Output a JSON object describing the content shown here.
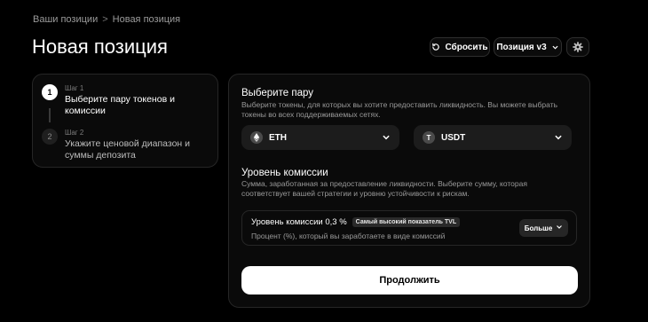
{
  "breadcrumb": {
    "parent": "Ваши позиции",
    "separator": ">",
    "current": "Новая позиция"
  },
  "header": {
    "title": "Новая позиция",
    "reset_label": "Сбросить",
    "version_label": "Позиция v3"
  },
  "steps": [
    {
      "number": "1",
      "label": "Шаг 1",
      "title": "Выберите пару токенов и комиссии"
    },
    {
      "number": "2",
      "label": "Шаг 2",
      "title": "Укажите ценовой диапазон и суммы депозита"
    }
  ],
  "pair": {
    "title": "Выберите пару",
    "description": "Выберите токены, для которых вы хотите предоставить ликвидность. Вы можете выбрать токены во всех поддерживаемых сетях.",
    "token_a": {
      "symbol": "ETH",
      "icon": "eth-icon"
    },
    "token_b": {
      "symbol": "USDT",
      "icon": "usdt-icon",
      "glyph": "T"
    }
  },
  "fee": {
    "title": "Уровень комиссии",
    "description": "Сумма, заработанная за предоставление ликвидности. Выберите сумму, которая соответствует вашей стратегии и уровню устойчивости к рискам.",
    "selected_label": "Уровень комиссии 0,3 %",
    "badge": "Самый высокий показатель TVL",
    "selected_desc": "Процент (%), который вы заработаете в виде комиссий",
    "more_label": "Больше"
  },
  "continue_label": "Продолжить",
  "colors": {
    "background": "#000000",
    "card": "#0a0a0a",
    "primary_button": "#ffffff"
  }
}
